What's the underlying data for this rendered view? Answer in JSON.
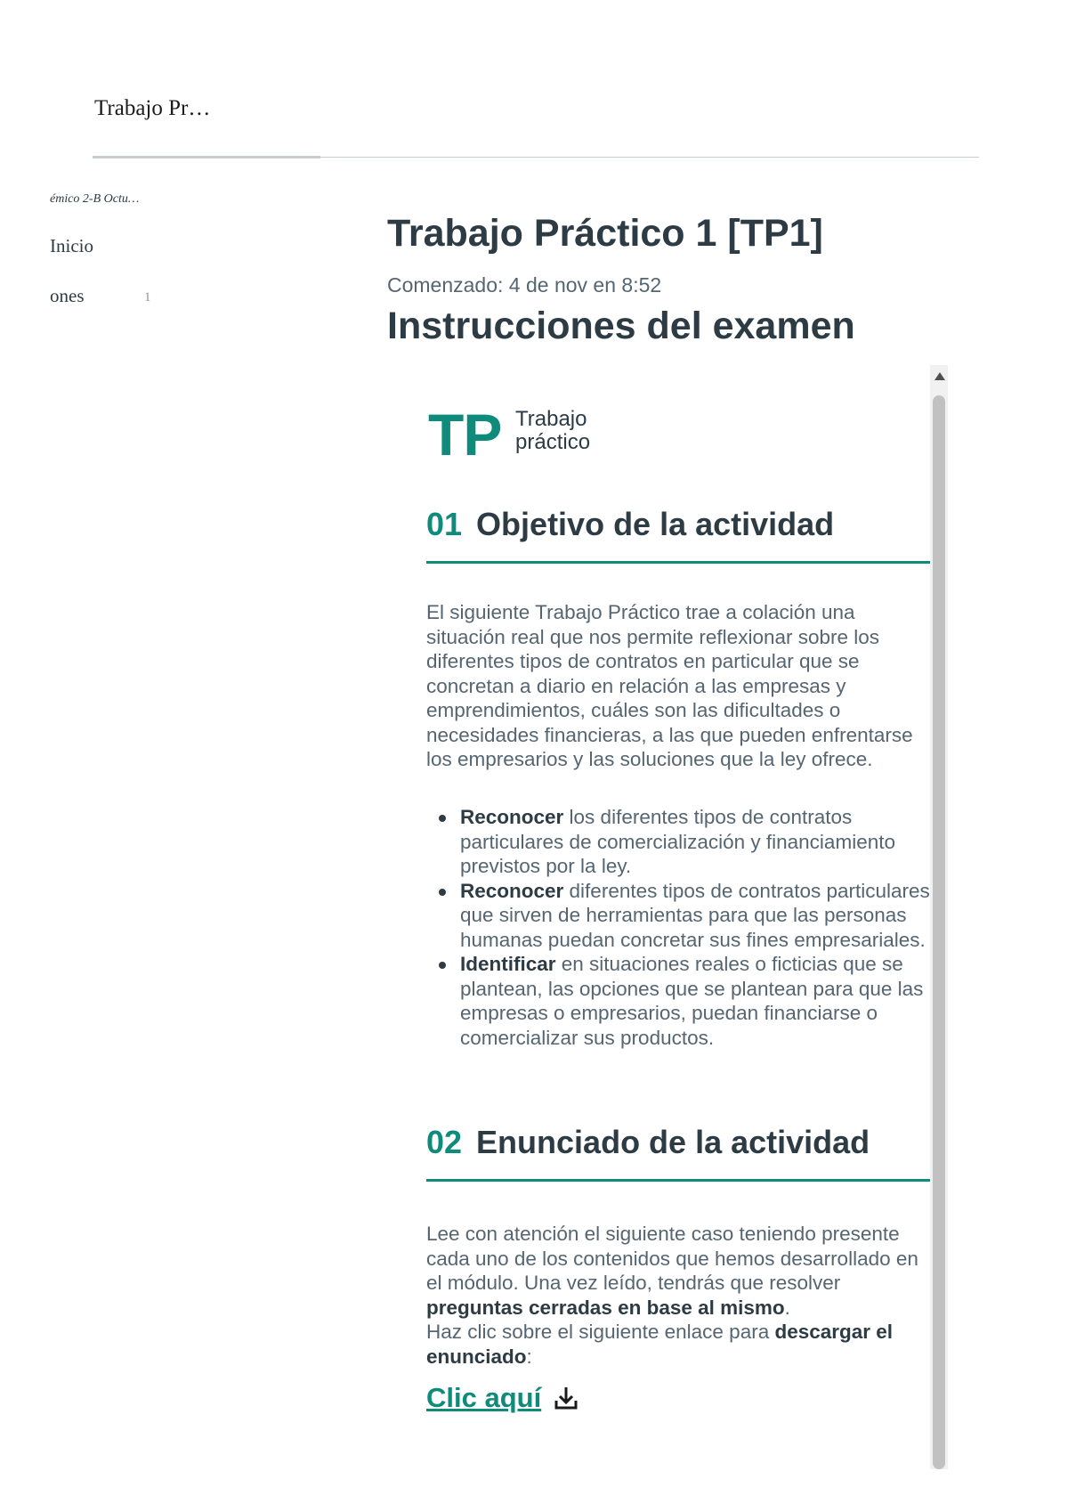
{
  "header": {
    "title": "Trabajo Pr…"
  },
  "sidebar": {
    "course": "émico 2-B Octu…",
    "items": [
      {
        "label": "Inicio"
      },
      {
        "label": "ones",
        "badge": "1"
      }
    ]
  },
  "main": {
    "title": "Trabajo Práctico 1 [TP1]",
    "started": "Comenzado: 4 de nov en 8:52",
    "instructions_title": "Instrucciones del examen"
  },
  "content": {
    "logo": {
      "letters": "TP",
      "line1": "Trabajo",
      "line2": "práctico"
    },
    "section1": {
      "number": "01",
      "title": "Objetivo de la actividad",
      "paragraph": "El siguiente Trabajo Práctico trae a colación una situación real que nos permite reflexionar sobre los diferentes tipos de contratos en particular que se concretan a diario en relación a las empresas y emprendimientos, cuáles son las dificultades o necesidades financieras, a las que pueden enfrentarse los empresarios y las soluciones que la ley ofrece.",
      "bullets": [
        {
          "strong": "Reconocer",
          "text": " los diferentes tipos de contratos particulares de comercialización y financiamiento previstos por la ley."
        },
        {
          "strong": "Reconocer",
          "text": " diferentes tipos de contratos particulares que sirven de herramientas para que las personas humanas puedan concretar sus fines empresariales."
        },
        {
          "strong": "Identificar",
          "text": " en situaciones reales o ficticias que se plantean, las opciones que se plantean para que las empresas o empresarios, puedan financiarse o comercializar sus productos."
        }
      ]
    },
    "section2": {
      "number": "02",
      "title": "Enunciado de la actividad",
      "p1": "Lee con atención el siguiente caso teniendo presente cada uno de los contenidos que hemos desarrollado en el módulo. Una vez leído, tendrás que resolver ",
      "p1_strong": "preguntas cerradas en base al mismo",
      "p1_end": ".",
      "p2": "Haz clic sobre el siguiente enlace para ",
      "p2_strong": "descargar el enunciado",
      "p2_end": ":",
      "link": "Clic aquí"
    }
  },
  "colors": {
    "accent": "#0f8b7b",
    "text": "#2d3b45",
    "muted": "#556572"
  }
}
